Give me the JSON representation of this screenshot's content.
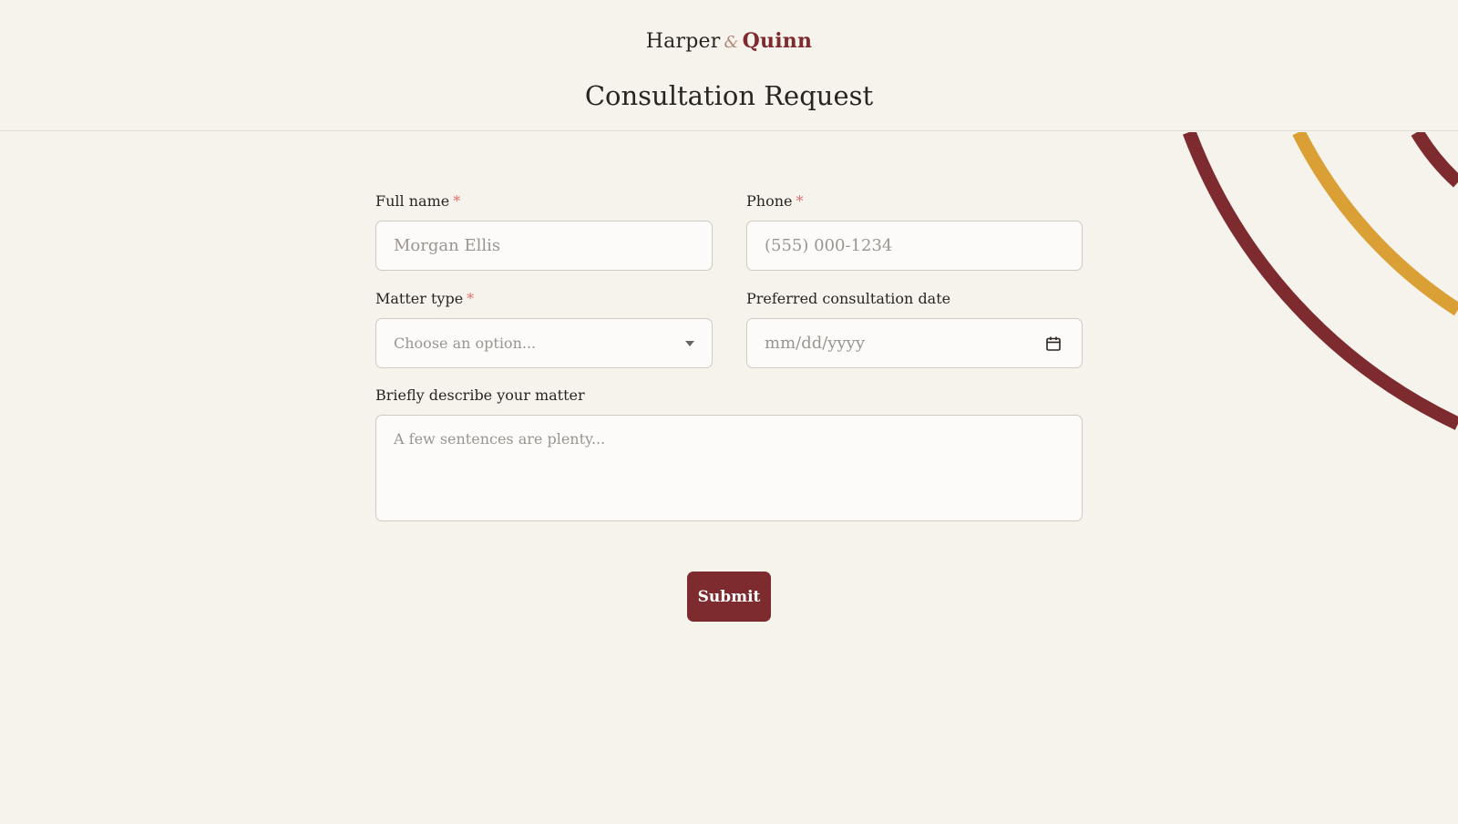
{
  "brand": {
    "first": "Harper",
    "amp": "&",
    "second": "Quinn"
  },
  "page_title": "Consultation Request",
  "form": {
    "full_name": {
      "label": "Full name",
      "required": "*",
      "placeholder": "Morgan Ellis"
    },
    "phone": {
      "label": "Phone",
      "required": "*",
      "placeholder": "(555) 000-1234"
    },
    "matter_type": {
      "label": "Matter type",
      "required": "*",
      "placeholder": "Choose an option..."
    },
    "date": {
      "label": "Preferred consultation date",
      "placeholder": "mm/dd/yyyy"
    },
    "description": {
      "label": "Briefly describe your matter",
      "placeholder": "A few sentences are plenty..."
    },
    "submit_label": "Submit"
  },
  "icons": {
    "select": "chevron-down-icon",
    "date": "calendar-icon"
  },
  "colors": {
    "accent": "#7d2b2f",
    "gold": "#dba035",
    "background": "#f6f3ed"
  }
}
